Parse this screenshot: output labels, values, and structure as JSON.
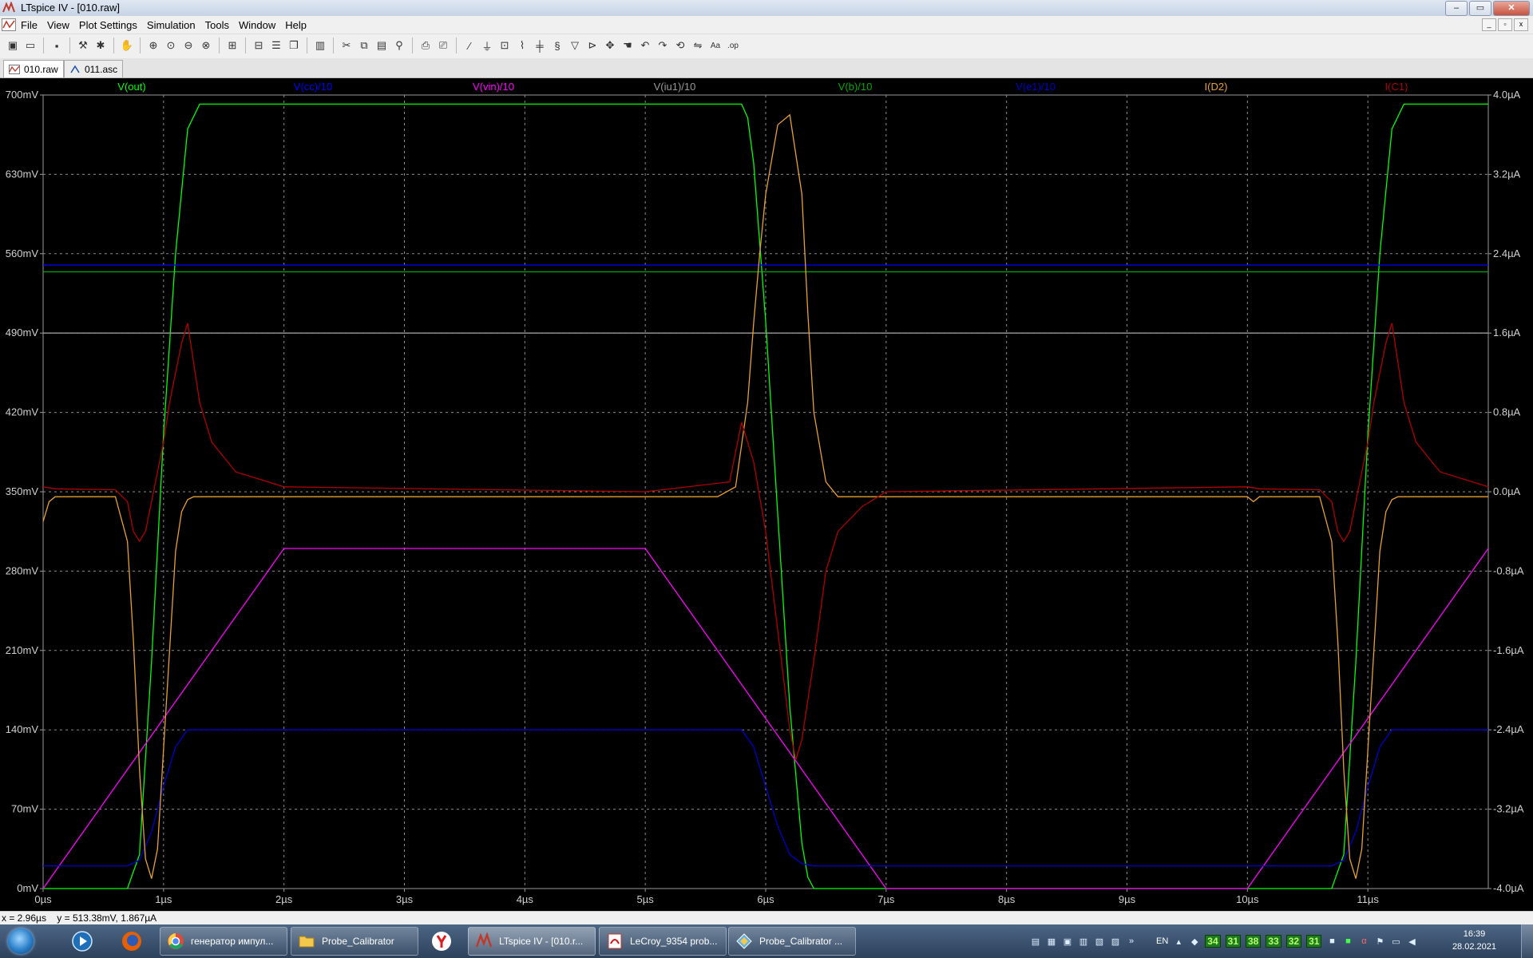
{
  "window": {
    "title": "LTspice IV - [010.raw]",
    "controls": [
      "–",
      "▭",
      "✕"
    ]
  },
  "menu": [
    "File",
    "View",
    "Plot Settings",
    "Simulation",
    "Tools",
    "Window",
    "Help"
  ],
  "mdi_controls": [
    "_",
    "▫",
    "x"
  ],
  "toolbar_icons": [
    "new-schematic-icon",
    "open-icon",
    "save-icon",
    "control-panel-icon",
    "run-icon",
    "pan-icon",
    "zoom-in-icon",
    "zoom-area-icon",
    "zoom-out-icon",
    "zoom-fit-icon",
    "autorange-icon",
    "mark-icon",
    "tile-horizontal-icon",
    "cascade-icon",
    "tile-vertical-icon",
    "cut-icon",
    "copy-icon",
    "paste-icon",
    "find-icon",
    "print-icon",
    "print-setup-icon",
    "wire-icon",
    "ground-icon",
    "label-icon",
    "resistor-icon",
    "capacitor-icon",
    "inductor-icon",
    "diode-icon",
    "component-icon",
    "move-icon",
    "drag-icon",
    "undo-icon",
    "redo-icon",
    "rotate-icon",
    "mirror-icon",
    "text-icon",
    "spice-directive-icon"
  ],
  "tabs": [
    {
      "label": "010.raw",
      "icon": "waveform-icon",
      "active": true
    },
    {
      "label": "011.asc",
      "icon": "schematic-icon",
      "active": false
    }
  ],
  "status": {
    "cursor": "x = 2.96µs    y = 513.38mV, 1.867µA"
  },
  "chart_data": {
    "type": "line",
    "background": "#000000",
    "grid": true,
    "xlabel": "",
    "ylabel": "",
    "xlim": [
      0,
      12
    ],
    "x_ticks": [
      "0µs",
      "1µs",
      "2µs",
      "3µs",
      "4µs",
      "5µs",
      "6µs",
      "7µs",
      "8µs",
      "9µs",
      "10µs",
      "11µs"
    ],
    "ylim_left": [
      0,
      700
    ],
    "y_left_ticks": [
      "0mV",
      "70mV",
      "140mV",
      "210mV",
      "280mV",
      "350mV",
      "420mV",
      "490mV",
      "560mV",
      "630mV",
      "700mV"
    ],
    "ylim_right": [
      -4.0,
      4.0
    ],
    "y_right_ticks": [
      "-4.0µA",
      "-3.2µA",
      "-2.4µA",
      "-1.6µA",
      "-0.8µA",
      "0.0µA",
      "0.8µA",
      "1.6µA",
      "2.4µA",
      "3.2µA",
      "4.0µA"
    ],
    "series": [
      {
        "name": "V(out)",
        "color": "#00ff00",
        "axis": "left",
        "x": [
          0,
          0.7,
          0.8,
          0.9,
          1.0,
          1.1,
          1.2,
          1.3,
          5.8,
          5.85,
          5.9,
          6.0,
          6.1,
          6.2,
          6.3,
          6.35,
          6.4,
          10.0,
          10.7,
          10.8,
          10.9,
          11.0,
          11.1,
          11.2,
          11.3,
          12.0
        ],
        "y": [
          0,
          0,
          30,
          200,
          400,
          560,
          670,
          692,
          692,
          680,
          640,
          500,
          330,
          160,
          40,
          10,
          0,
          0,
          0,
          30,
          200,
          400,
          560,
          670,
          692,
          692
        ]
      },
      {
        "name": "V(cc)/10",
        "color": "#0000ff",
        "axis": "left",
        "x": [
          0,
          12
        ],
        "y": [
          550,
          550
        ]
      },
      {
        "name": "V(vin)/10",
        "color": "#ff00ff",
        "axis": "left",
        "x": [
          0,
          2,
          5,
          7,
          10,
          12
        ],
        "y": [
          0,
          300,
          300,
          0,
          0,
          300
        ]
      },
      {
        "name": "V(iu1)/10",
        "color": "#999999",
        "axis": "left",
        "x": [
          0,
          12
        ],
        "y": [
          490,
          490
        ]
      },
      {
        "name": "V(b)/10",
        "color": "#00aa00",
        "axis": "left",
        "x": [
          0,
          12
        ],
        "y": [
          544,
          544
        ]
      },
      {
        "name": "V(e1)/10",
        "color": "#0000cc",
        "axis": "left",
        "x": [
          0,
          0.7,
          0.8,
          0.9,
          1.0,
          1.1,
          1.2,
          5.8,
          5.9,
          6.0,
          6.1,
          6.2,
          6.3,
          6.4,
          10.0,
          10.7,
          10.8,
          10.9,
          11.0,
          11.1,
          11.2,
          12.0
        ],
        "y": [
          20,
          20,
          25,
          50,
          90,
          125,
          140,
          140,
          125,
          90,
          55,
          30,
          22,
          20,
          20,
          20,
          25,
          50,
          90,
          125,
          140,
          140
        ]
      },
      {
        "name": "I(D2)",
        "color": "#e8a030",
        "axis": "right",
        "x": [
          0,
          0.05,
          0.1,
          0.6,
          0.7,
          0.75,
          0.8,
          0.85,
          0.9,
          0.95,
          1.0,
          1.05,
          1.1,
          1.15,
          1.2,
          1.25,
          1.3,
          1.4,
          5.0,
          5.6,
          5.75,
          5.85,
          5.9,
          5.95,
          6.0,
          6.1,
          6.2,
          6.3,
          6.35,
          6.4,
          6.5,
          6.6,
          7.0,
          10.0,
          10.05,
          10.1,
          10.6,
          10.7,
          10.75,
          10.8,
          10.85,
          10.9,
          10.95,
          11.0,
          11.05,
          11.1,
          11.15,
          11.2,
          11.25,
          11.3,
          11.4,
          12.0
        ],
        "y": [
          -0.3,
          -0.1,
          -0.05,
          -0.05,
          -0.5,
          -1.5,
          -2.8,
          -3.7,
          -3.9,
          -3.6,
          -2.6,
          -1.6,
          -0.6,
          -0.2,
          -0.08,
          -0.05,
          -0.05,
          -0.05,
          -0.05,
          -0.05,
          0.05,
          0.9,
          1.7,
          2.4,
          3.0,
          3.7,
          3.8,
          3.0,
          1.8,
          0.8,
          0.1,
          -0.05,
          -0.05,
          -0.05,
          -0.1,
          -0.05,
          -0.05,
          -0.5,
          -1.5,
          -2.8,
          -3.7,
          -3.9,
          -3.6,
          -2.6,
          -1.6,
          -0.6,
          -0.2,
          -0.08,
          -0.05,
          -0.05,
          -0.05,
          -0.05
        ]
      },
      {
        "name": "I(C1)",
        "color": "#b00000",
        "axis": "right",
        "x": [
          0,
          0.1,
          0.6,
          0.7,
          0.75,
          0.8,
          0.85,
          0.9,
          0.95,
          1.0,
          1.05,
          1.1,
          1.15,
          1.2,
          1.25,
          1.3,
          1.4,
          1.6,
          2.0,
          5.0,
          5.7,
          5.8,
          5.9,
          6.0,
          6.1,
          6.2,
          6.25,
          6.3,
          6.4,
          6.5,
          6.6,
          6.8,
          7.0,
          10.0,
          10.1,
          10.6,
          10.7,
          10.75,
          10.8,
          10.85,
          10.9,
          10.95,
          11.0,
          11.05,
          11.1,
          11.15,
          11.2,
          11.25,
          11.3,
          11.4,
          11.6,
          12.0
        ],
        "y": [
          0.05,
          0.03,
          0.02,
          -0.1,
          -0.4,
          -0.5,
          -0.4,
          -0.1,
          0.2,
          0.5,
          0.9,
          1.2,
          1.5,
          1.7,
          1.3,
          0.9,
          0.5,
          0.2,
          0.05,
          0.0,
          0.1,
          0.7,
          0.3,
          -0.4,
          -1.4,
          -2.4,
          -2.7,
          -2.5,
          -1.7,
          -0.8,
          -0.4,
          -0.15,
          0.0,
          0.05,
          0.03,
          0.02,
          -0.1,
          -0.4,
          -0.5,
          -0.4,
          -0.1,
          0.2,
          0.5,
          0.9,
          1.2,
          1.5,
          1.7,
          1.3,
          0.9,
          0.5,
          0.2,
          0.05
        ]
      }
    ]
  },
  "taskbar": {
    "buttons": [
      {
        "label": "генератор импул...",
        "icon": "chrome-icon"
      },
      {
        "label": "Probe_Calibrator",
        "icon": "folder-icon"
      },
      {
        "label": "LTspice IV - [010.r...",
        "icon": "ltspice-icon",
        "active": true
      },
      {
        "label": "LeCroy_9354 prob...",
        "icon": "pdf-icon"
      },
      {
        "label": "Probe_Calibrator ...",
        "icon": "diagram-icon"
      }
    ],
    "lang": "EN",
    "tray_numbers": [
      "34",
      "31",
      "38",
      "33",
      "32",
      "31"
    ],
    "time": "16:39",
    "date": "28.02.2021"
  }
}
